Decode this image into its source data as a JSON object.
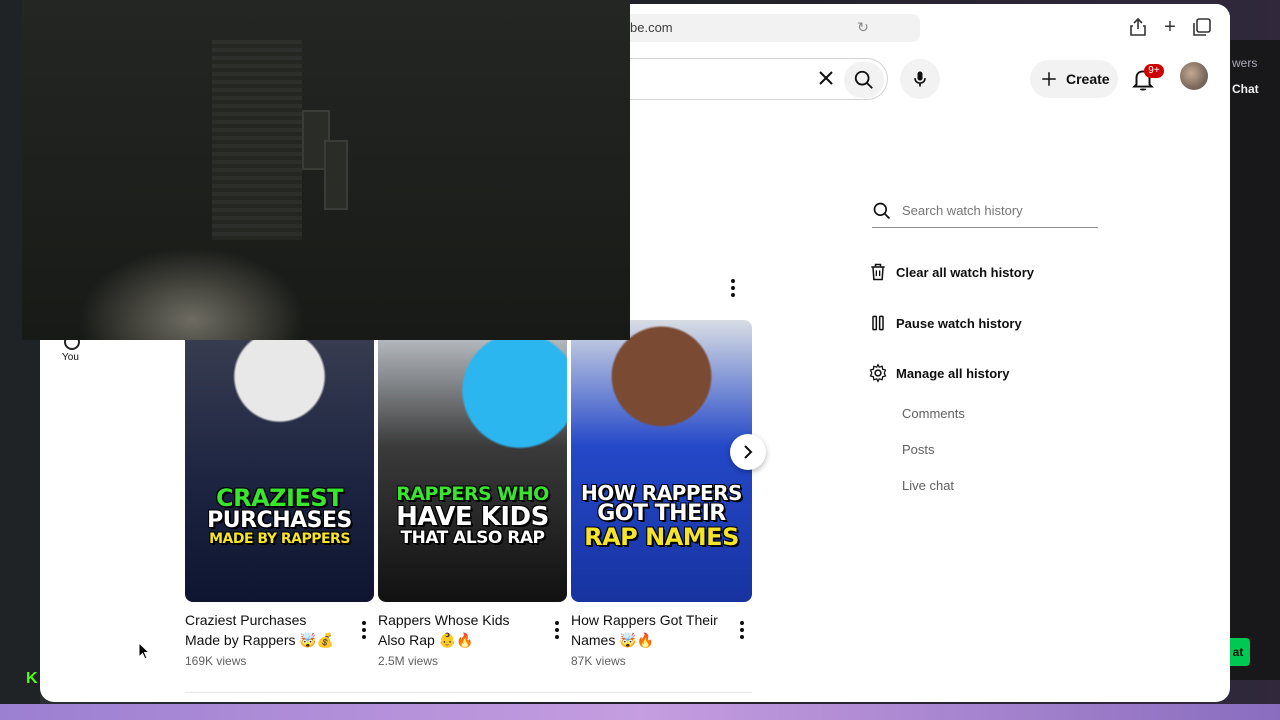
{
  "browser": {
    "url": "be.com"
  },
  "background_app": {
    "viewers_label": "wers",
    "chat_label": "Chat",
    "chat_button_label": "at"
  },
  "youtube": {
    "header": {
      "create_label": "Create",
      "notifications_badge": "9+"
    },
    "guide": {
      "you_label": "You"
    },
    "shorts": [
      {
        "thumb_lines": [
          "CRAZIEST",
          "PURCHASES",
          "MADE BY RAPPERS"
        ],
        "title": "Craziest Purchases Made by Rappers 🤯💰",
        "views": "169K views"
      },
      {
        "thumb_lines": [
          "RAPPERS WHO",
          "HAVE KIDS",
          "THAT ALSO RAP"
        ],
        "title": "Rappers Whose Kids Also Rap 👶🔥",
        "views": "2.5M views"
      },
      {
        "thumb_lines": [
          "HOW RAPPERS",
          "GOT THEIR",
          "RAP NAMES"
        ],
        "title": "How Rappers Got Their Names 🤯🔥",
        "views": "87K views"
      }
    ],
    "history_panel": {
      "search_placeholder": "Search watch history",
      "clear_label": "Clear all watch history",
      "pause_label": "Pause watch history",
      "manage_label": "Manage all history",
      "sub_items": [
        "Comments",
        "Posts",
        "Live chat"
      ]
    }
  },
  "colors": {
    "thumb_green": "#39e62f",
    "thumb_yellow": "#f5e52a",
    "thumb_blue": "#1f4fd8",
    "badge_red": "#cc0000"
  }
}
